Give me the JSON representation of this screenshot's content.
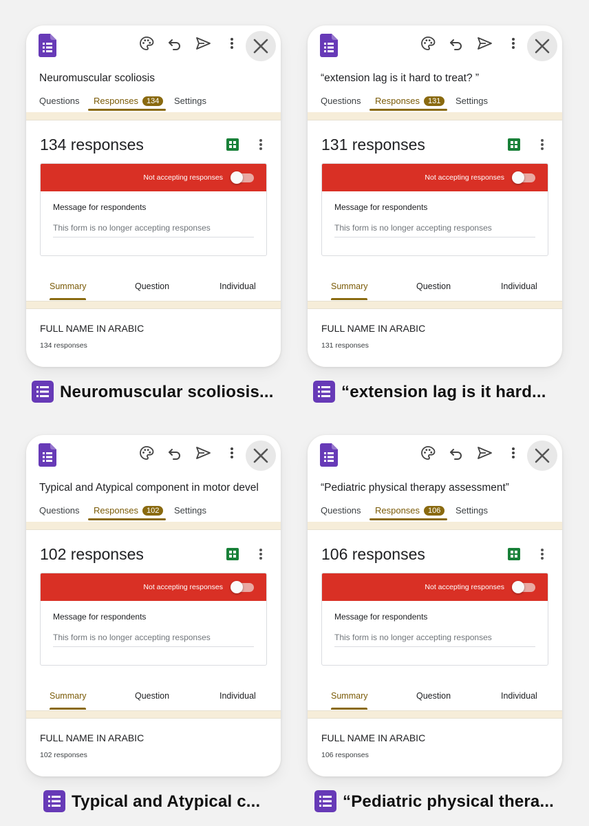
{
  "common": {
    "tabs": {
      "questions": "Questions",
      "responses": "Responses",
      "settings": "Settings"
    },
    "status": "Not accepting responses",
    "message_label": "Message for respondents",
    "message_value": "This form is no longer accepting responses",
    "subtabs": {
      "summary": "Summary",
      "question": "Question",
      "individual": "Individual"
    },
    "question_title": "FULL NAME IN ARABIC",
    "icons": [
      "form-icon",
      "palette-icon",
      "undo-icon",
      "send-icon",
      "more-vert-icon",
      "close-icon",
      "sheets-icon"
    ]
  },
  "colors": {
    "accent": "#8a6a10",
    "banner": "#d93025",
    "forms_purple": "#673ab7",
    "sheets_green": "#188038"
  },
  "forms": [
    {
      "title": "Neuromuscular scoliosis",
      "badge": "134",
      "count_label": "134 responses",
      "response_count": "134 responses",
      "caption": "Neuromuscular scoliosis..."
    },
    {
      "title": "“extension lag is it hard to treat? ”",
      "badge": "131",
      "count_label": "131 responses",
      "response_count": "131 responses",
      "caption": "“extension lag is it hard..."
    },
    {
      "title": "Typical and Atypical component in motor devel",
      "badge": "102",
      "count_label": "102 responses",
      "response_count": "102 responses",
      "caption": "Typical and Atypical c..."
    },
    {
      "title": "“Pediatric physical therapy assessment”",
      "badge": "106",
      "count_label": "106 responses",
      "response_count": "106 responses",
      "caption": "“Pediatric physical thera..."
    }
  ]
}
